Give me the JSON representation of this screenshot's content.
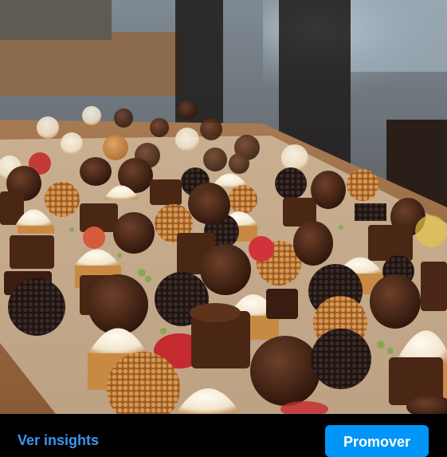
{
  "actions": {
    "insights_label": "Ver insights",
    "promote_label": "Promover"
  },
  "colors": {
    "link": "#3797f0",
    "button_bg": "#0095f6",
    "bar_bg": "#000000"
  }
}
